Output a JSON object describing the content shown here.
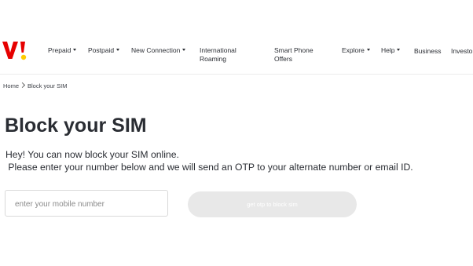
{
  "brand": {
    "logo_text": "V!",
    "primary_color": "#e60000",
    "accent_color": "#fecb00"
  },
  "nav": {
    "items": [
      {
        "label": "Prepaid",
        "dropdown": true
      },
      {
        "label": "Postpaid",
        "dropdown": true
      },
      {
        "label": "New Connection",
        "dropdown": true
      },
      {
        "label": "International",
        "label2": "Roaming",
        "dropdown": false
      },
      {
        "label": "Smart Phone",
        "label2": "Offers",
        "dropdown": false
      },
      {
        "label": "Explore",
        "dropdown": true
      },
      {
        "label": "Help",
        "dropdown": true
      },
      {
        "label": "Business",
        "dropdown": false
      },
      {
        "label": "Investo",
        "dropdown": false
      }
    ]
  },
  "breadcrumb": {
    "home": "Home",
    "current": "Block your SIM"
  },
  "main": {
    "title": "Block your SIM",
    "line1": "Hey! You can now block your SIM online.",
    "line2": " Please enter your number below and we will send an OTP to your alternate number or email ID.",
    "input_placeholder": "enter your mobile number",
    "input_value": "",
    "otp_button_label": "get otp to block sim",
    "otp_button_state": "disabled"
  }
}
